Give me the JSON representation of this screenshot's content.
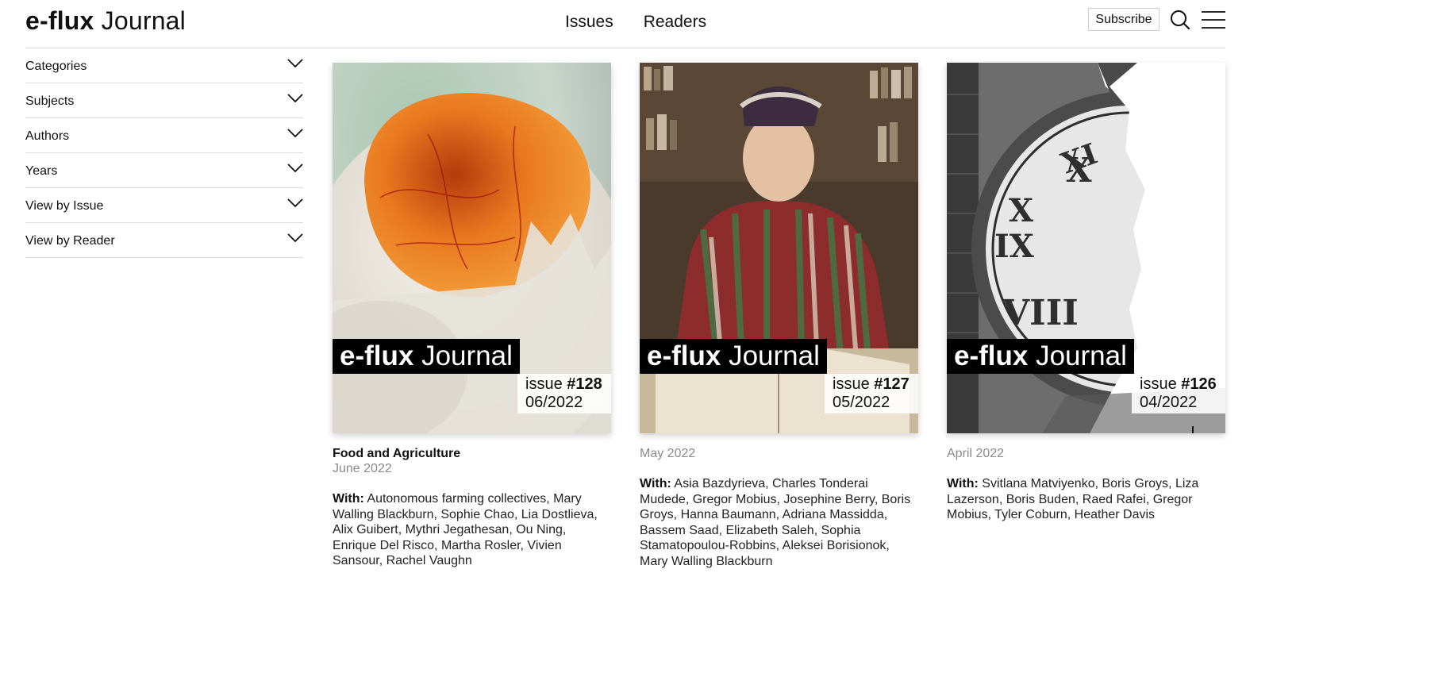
{
  "header": {
    "logo_bold": "e-flux",
    "logo_light": "Journal",
    "nav": [
      "Issues",
      "Readers"
    ],
    "subscribe_label": "Subscribe",
    "icons": [
      "search-icon",
      "menu-icon"
    ]
  },
  "sidebar": {
    "filters": [
      {
        "label": "Categories"
      },
      {
        "label": "Subjects"
      },
      {
        "label": "Authors"
      },
      {
        "label": "Years"
      },
      {
        "label": "View by Issue"
      },
      {
        "label": "View by Reader"
      }
    ]
  },
  "issues": [
    {
      "brand_bold": "e-flux",
      "brand_light": "Journal",
      "issue_word": "issue",
      "issue_number": "#128",
      "issue_date": "06/2022",
      "title": "Food and Agriculture",
      "date": "June 2022",
      "with_label": "With:",
      "contributors": "Autonomous farming collectives, Mary Walling Blackburn, Sophie Chao, Lia Dostlieva, Alix Guibert, Mythri Jegathesan, Ou Ning, Enrique Del Risco, Martha Rosler, Vivien Sansour, Rachel Vaughn"
    },
    {
      "brand_bold": "e-flux",
      "brand_light": "Journal",
      "issue_word": "issue",
      "issue_number": "#127",
      "issue_date": "05/2022",
      "title": "",
      "date": "May 2022",
      "with_label": "With:",
      "contributors": "Asia Bazdyrieva, Charles Tonderai Mudede, Gregor Mobius, Josephine Berry, Boris Groys, Hanna Baumann, Adriana Massidda, Bassem Saad, Elizabeth Saleh, Sophia Stamatopoulou-Robbins, Aleksei Borisionok, Mary Walling Blackburn"
    },
    {
      "brand_bold": "e-flux",
      "brand_light": "Journal",
      "issue_word": "issue",
      "issue_number": "#126",
      "issue_date": "04/2022",
      "title": "",
      "date": "April 2022",
      "with_label": "With:",
      "contributors": "Svitlana Matviyenko, Boris Groys, Liza Lazerson, Boris Buden, Raed Rafei, Gregor Mobius, Tyler Coburn, Heather Davis"
    }
  ]
}
